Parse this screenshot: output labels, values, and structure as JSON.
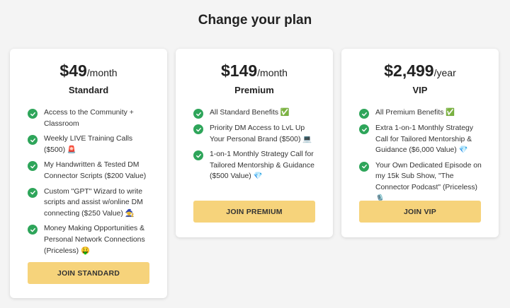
{
  "page": {
    "title": "Change your plan"
  },
  "plans": [
    {
      "price": "$49",
      "period": "/month",
      "name": "Standard",
      "features": [
        "Access to the Community + Classroom",
        "Weekly LIVE Training Calls ($500) 🚨",
        "My Handwritten & Tested DM Connector Scripts ($200 Value)",
        "Custom \"GPT\" Wizard to write scripts and assist w/online DM connecting ($250 Value) 🧙",
        "Money Making Opportunities & Personal Network Connections (Priceless) 🤑"
      ],
      "button_label": "Join Standard"
    },
    {
      "price": "$149",
      "period": "/month",
      "name": "Premium",
      "features": [
        "All Standard Benefits ✅",
        "Priority DM Access to LvL Up Your Personal Brand ($500) 💻",
        "1-on-1 Monthly Strategy Call for Tailored Mentorship & Guidance ($500 Value) 💎"
      ],
      "button_label": "Join Premium"
    },
    {
      "price": "$2,499",
      "period": "/year",
      "name": "VIP",
      "features": [
        "All Premium Benefits ✅",
        "Extra 1-on-1 Monthly Strategy Call for Tailored Mentorship & Guidance ($6,000 Value) 💎",
        "Your Own Dedicated Episode on my 15k Sub Show, \"The Connector Podcast\" (Priceless) 🎙️"
      ],
      "button_label": "Join VIP"
    }
  ],
  "colors": {
    "check": "#2ea55a",
    "button": "#f6d37b",
    "background": "#f4f4f4"
  },
  "icons": {
    "feature_marker": "check-circle-icon"
  }
}
